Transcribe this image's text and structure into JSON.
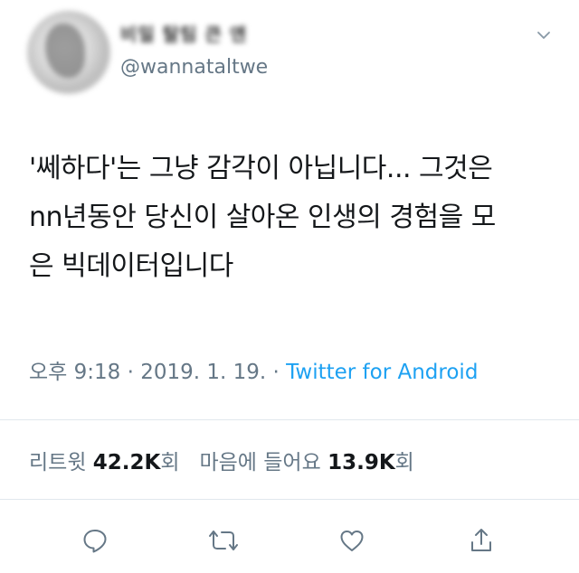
{
  "user": {
    "display_name": "비밀 탈팀 큰 앤",
    "handle": "@wannataltwe"
  },
  "tweet": {
    "lines": [
      "'쎄하다'는 그냥 감각이 아닙니다... 그것은",
      "nn년동안 당신이 살아온 인생의 경험을 모",
      "은 빅데이터입니다"
    ]
  },
  "meta": {
    "time": "오후 9:18",
    "separator1": " · ",
    "date": "2019. 1. 19.",
    "separator2": " · ",
    "source": "Twitter for Android"
  },
  "stats": {
    "retweet_label": "리트윗",
    "retweet_count": "42.2K",
    "retweet_unit": "회",
    "like_label": "마음에 들어요",
    "like_count": "13.9K",
    "like_unit": "회"
  },
  "actions": {
    "icons": [
      "reply-icon",
      "retweet-icon",
      "like-icon",
      "share-icon"
    ]
  },
  "colors": {
    "text": "#14171a",
    "secondary": "#657786",
    "accent": "#1da1f2",
    "divider": "#e1e8ed"
  }
}
